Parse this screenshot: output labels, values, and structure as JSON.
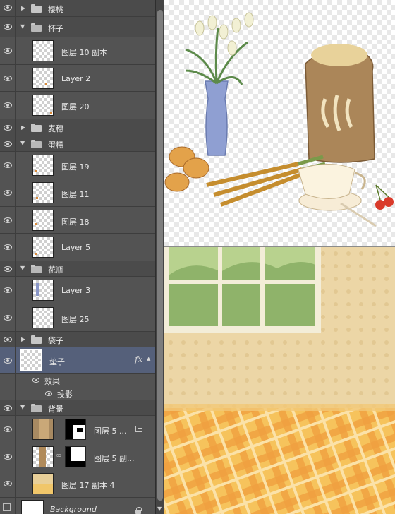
{
  "layers": [
    {
      "name": "樱桃",
      "kind": "group-closed"
    },
    {
      "name": "杯子",
      "kind": "group-open"
    },
    {
      "name": "图层 10 副本",
      "kind": "layer"
    },
    {
      "name": "Layer 2",
      "kind": "layer"
    },
    {
      "name": "图层 20",
      "kind": "layer"
    },
    {
      "name": "麦穗",
      "kind": "group-closed"
    },
    {
      "name": "蛋糕",
      "kind": "group-open"
    },
    {
      "name": "图层 19",
      "kind": "layer"
    },
    {
      "name": "图层 11",
      "kind": "layer"
    },
    {
      "name": "图层 18",
      "kind": "layer"
    },
    {
      "name": "Layer 5",
      "kind": "layer"
    },
    {
      "name": "花瓶",
      "kind": "group-open"
    },
    {
      "name": "Layer 3",
      "kind": "layer"
    },
    {
      "name": "图层 25",
      "kind": "layer"
    },
    {
      "name": "袋子",
      "kind": "group-closed"
    },
    {
      "name": "垫子",
      "kind": "layer",
      "selected": true,
      "fx": "fx"
    },
    {
      "name": "效果",
      "kind": "effect"
    },
    {
      "name": "投影",
      "kind": "effect-item"
    },
    {
      "name": "背景",
      "kind": "group-open"
    },
    {
      "name": "图层 5 ...",
      "kind": "masked-layer"
    },
    {
      "name": "图层 5 副...",
      "kind": "masked-layer"
    },
    {
      "name": "图层 17 副本 4",
      "kind": "layer"
    },
    {
      "name": "Background",
      "kind": "background-layer",
      "locked": true
    }
  ],
  "colors": {
    "panel_bg": "#535353",
    "selected_row": "#55607a",
    "accent_orange": "#f0a040",
    "wall": "#ecd6a6",
    "floor": "#f2b44d"
  },
  "icons": [
    "eye-icon",
    "folder-icon",
    "fx-icon",
    "lock-icon",
    "link-icon",
    "smart-object-icon"
  ]
}
